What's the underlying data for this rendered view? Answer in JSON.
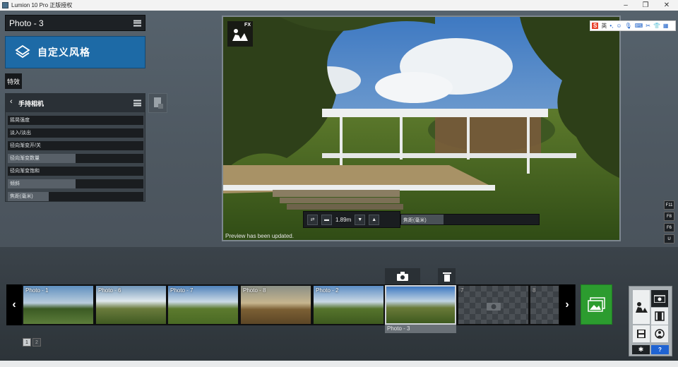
{
  "window": {
    "title": "Lumion 10 Pro 正版授权"
  },
  "photo_header": {
    "title": "Photo - 3"
  },
  "style_button": {
    "label": "自定义风格"
  },
  "effects_tab": {
    "label": "特效"
  },
  "effect_panel": {
    "title": "手持相机",
    "params": [
      {
        "label": "摇晃强度",
        "level": 0
      },
      {
        "label": "淡入/淡出",
        "level": 0
      },
      {
        "label": "径向渐变开/关",
        "level": 0
      },
      {
        "label": "径向渐变数量",
        "level": 0.5
      },
      {
        "label": "径向渐变饱和",
        "level": 0
      },
      {
        "label": "倾斜",
        "level": 0.5
      },
      {
        "label": "焦距(毫米)",
        "level": 0.3
      }
    ]
  },
  "viewport": {
    "fx_label": "FX",
    "preview_message": "Preview has been updated.",
    "camera_height": "1.89m",
    "focus_label": "焦距(毫米)"
  },
  "ime_toolbar": {
    "logo": "S",
    "lang": "英"
  },
  "function_keys": [
    "F11",
    "F8",
    "F6",
    "U"
  ],
  "photo_strip": {
    "slots": [
      {
        "label": "Photo - 1"
      },
      {
        "label": "Photo - 6"
      },
      {
        "label": "Photo - 7"
      },
      {
        "label": "Photo - 8"
      },
      {
        "label": "Photo - 2"
      },
      {
        "label": ""
      },
      {
        "label": "7"
      },
      {
        "label": "8"
      }
    ],
    "selected_label": "Photo - 3"
  },
  "pages": [
    "1",
    "2"
  ],
  "help": {
    "label": "?"
  },
  "colors": {
    "accent": "#1d6aa6",
    "render_green": "#2c9c2f",
    "help_blue": "#1f63d2"
  }
}
